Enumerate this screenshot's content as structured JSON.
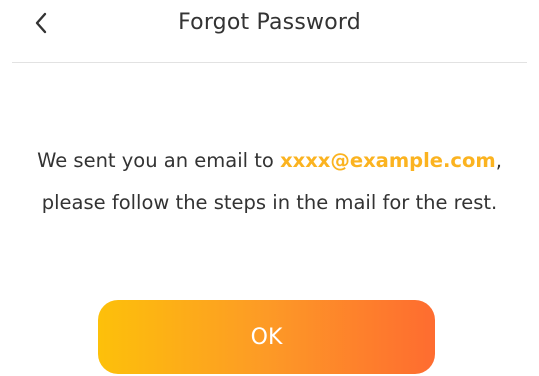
{
  "header": {
    "back_icon": "chevron-left-icon",
    "title": "Forgot Password"
  },
  "message": {
    "line1_prefix": "We sent you an email to ",
    "email": "xxxx@example.com",
    "line1_suffix": ",",
    "line2": "please follow the steps in the mail for the rest."
  },
  "actions": {
    "ok_label": "OK"
  },
  "colors": {
    "email_highlight": "#fbb320",
    "button_gradient_start": "#fdc00a",
    "button_gradient_end": "#fe6c30",
    "button_text": "#ffffff",
    "title_text": "#333333"
  }
}
